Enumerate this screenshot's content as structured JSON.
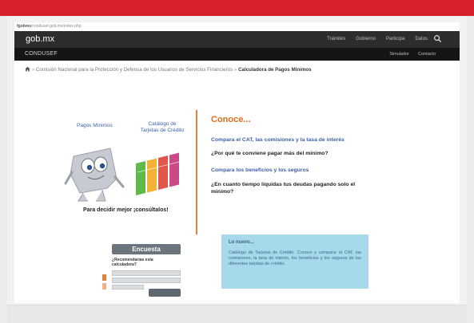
{
  "browser": {
    "url_host": "fgobmx",
    "url_path": "/condusef.gob.mx/index.php"
  },
  "header": {
    "logo": "gob.mx",
    "nav": [
      "Trámites",
      "Gobierno",
      "Participa",
      "Datos"
    ],
    "search_icon": "search-icon"
  },
  "subheader": {
    "brand": "CONDUSEF",
    "links": [
      "Simulador",
      "Contacto"
    ]
  },
  "breadcrumb": {
    "home_icon": "home-icon",
    "separator": "»",
    "parent": "Comisión Nacional para la Protección y Defensa de los Usuarios de Servicios Financieros",
    "current": "Calculadora de Pagos Mínimos"
  },
  "left_panel": {
    "label_pagos": "Pagos Mínimos",
    "label_catalogo_line1": "Catálogo de",
    "label_catalogo_line2": "Tarjetas de Crédito",
    "tagline": "Para decidir mejor ¡consúltalos!"
  },
  "right_panel": {
    "title": "Conoce...",
    "items": [
      "Compara el CAT, las comisiones y la tasa de interés",
      "¿Por qué te conviene pagar más del mínimo?",
      "Compara los beneficios y los seguros",
      "¿En cuanto tiempo liquidas tus deudas pagando solo el mínimo?"
    ]
  },
  "survey": {
    "title": "Encuesta",
    "question_line1": "¿Recomendarías esta",
    "question_line2": "calculadora?"
  },
  "note": {
    "title": "Lo nuevo...",
    "text": "Catálogo de Tarjetas de Crédito. Conoce y compara: el CAT, las comisiones, la tasa de interés, los beneficios y los seguros de las diferentes tarjetas de crédito."
  },
  "colors": {
    "accent_red": "#d8202a",
    "link_blue": "#3c5fa8",
    "orange": "#e06d1d",
    "note_bg": "#a6d9ea"
  }
}
